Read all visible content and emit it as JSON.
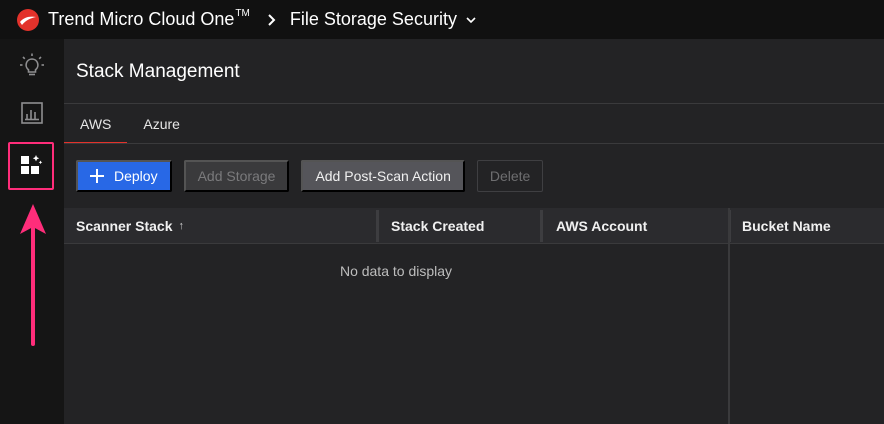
{
  "header": {
    "brand": "Trend Micro Cloud One",
    "brand_tm": "TM",
    "product": "File Storage Security"
  },
  "rail": {
    "items": [
      {
        "icon": "lightbulb-icon"
      },
      {
        "icon": "report-chart-icon"
      },
      {
        "icon": "stack-management-icon",
        "active": true
      }
    ]
  },
  "page": {
    "title": "Stack Management",
    "tabs": [
      {
        "label": "AWS",
        "active": true
      },
      {
        "label": "Azure",
        "active": false
      }
    ]
  },
  "toolbar": {
    "deploy_label": "Deploy",
    "add_storage_label": "Add Storage",
    "add_post_scan_label": "Add Post-Scan Action",
    "delete_label": "Delete"
  },
  "table": {
    "columns": [
      {
        "label": "Scanner Stack",
        "sort": "↑"
      },
      {
        "label": "Stack Created"
      },
      {
        "label": "AWS Account"
      },
      {
        "label": "Bucket Name"
      }
    ],
    "empty_message": "No data to display"
  },
  "colors": {
    "accent": "#2868e6",
    "tab_underline": "#e3322b",
    "highlight": "#ff2d7a",
    "logo_red": "#e3322b"
  }
}
